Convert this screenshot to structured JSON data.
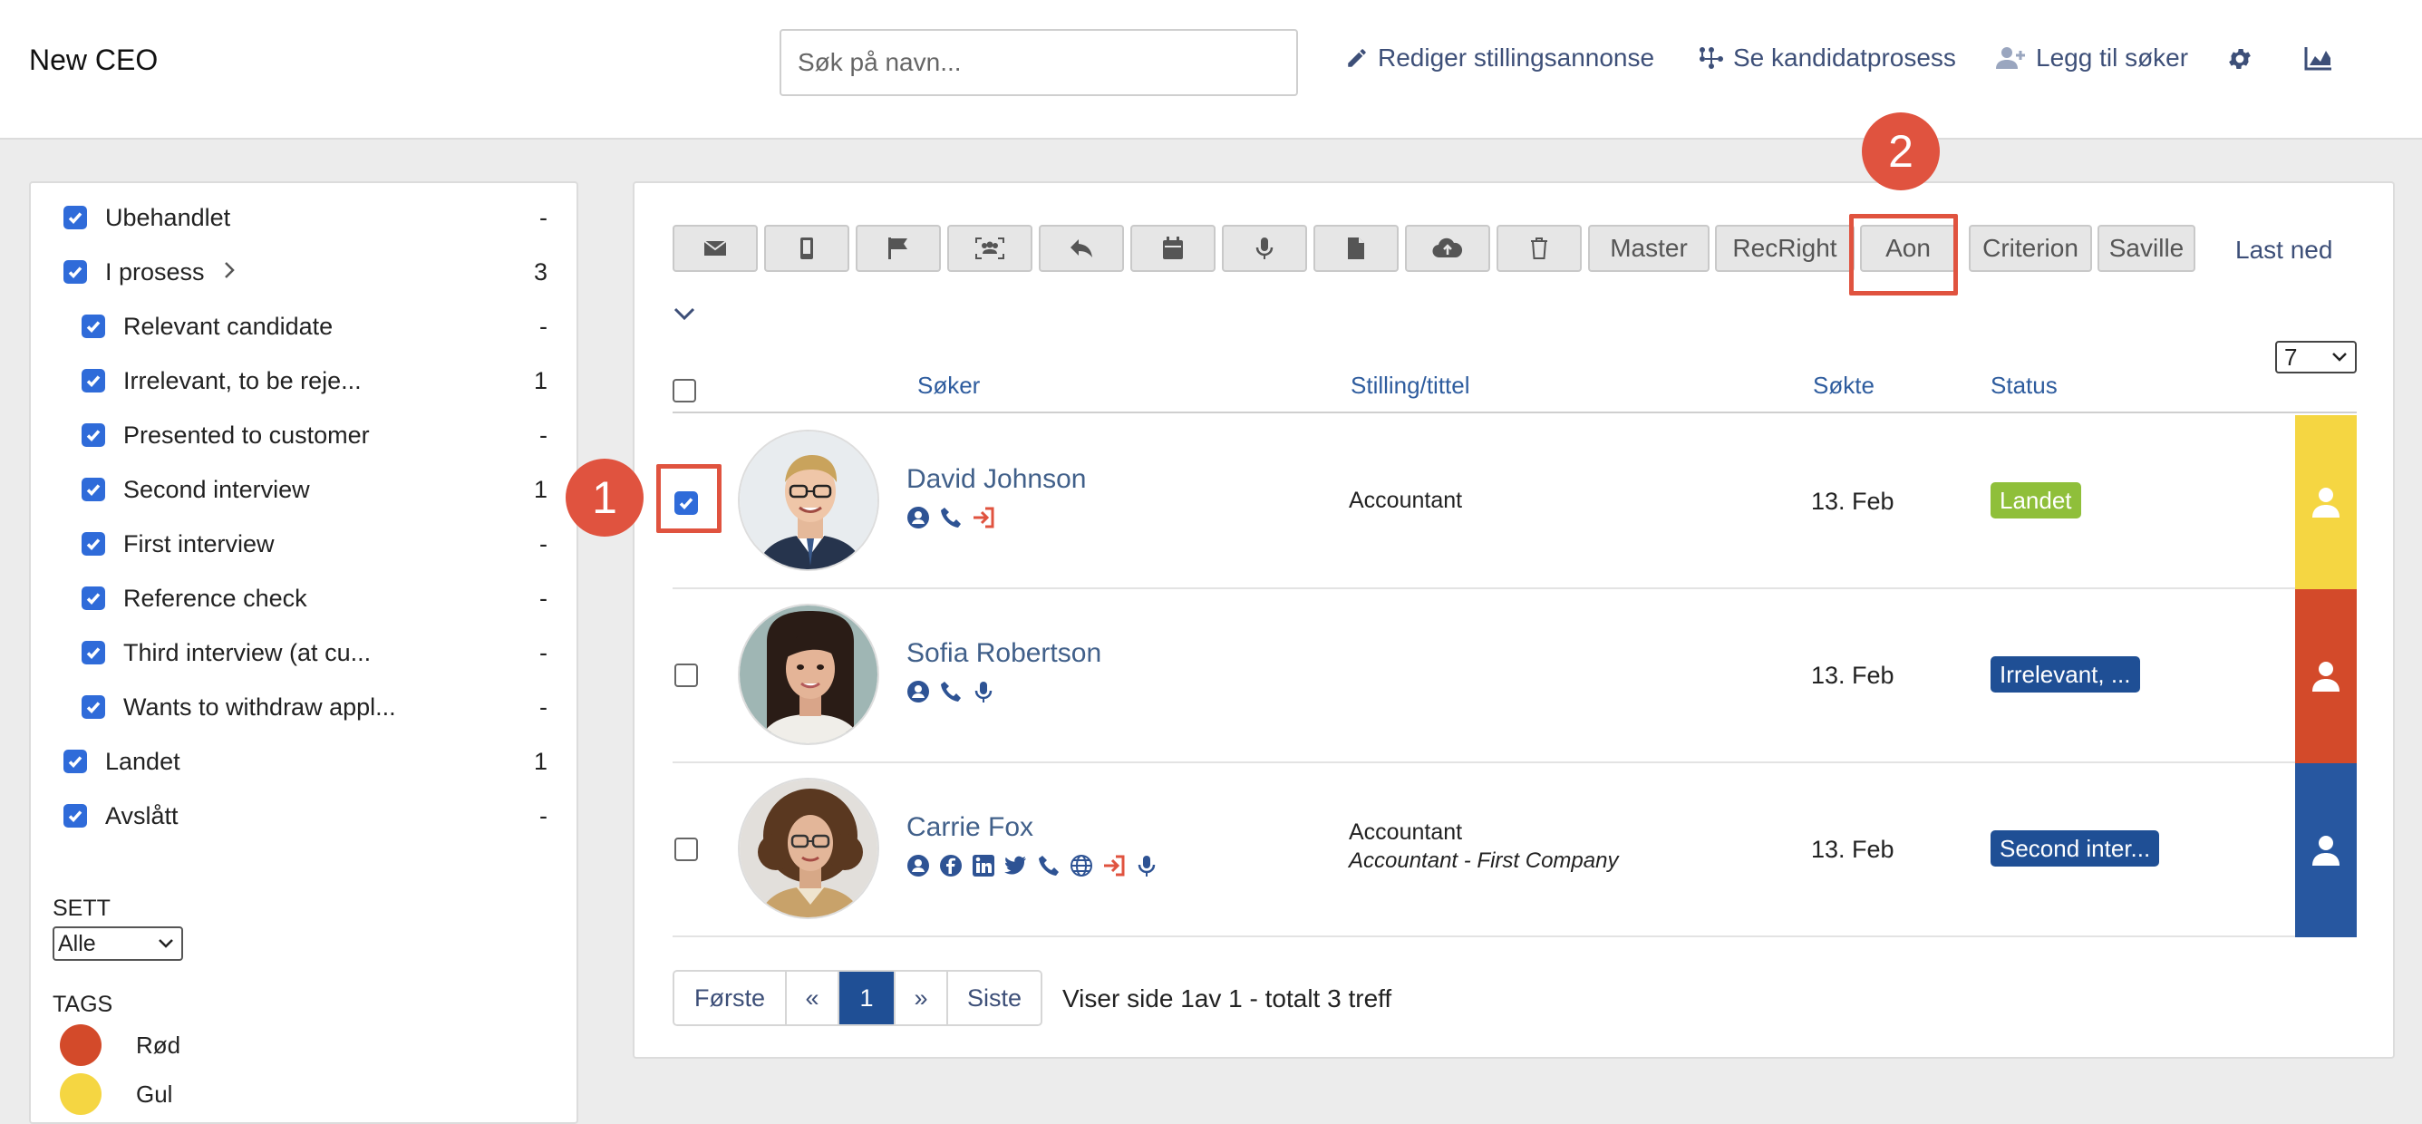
{
  "header": {
    "job_title": "New CEO",
    "search_placeholder": "Søk på navn...",
    "edit_ad_label": "Rediger stillingsannonse",
    "candidate_process_label": "Se kandidatprosess",
    "add_applicant_label": "Legg til søker"
  },
  "sidebar": {
    "filters": [
      {
        "label": "Ubehandlet",
        "count": "-",
        "indent": 0
      },
      {
        "label": "I prosess",
        "count": "3",
        "indent": 0,
        "expandable": true
      },
      {
        "label": "Relevant candidate",
        "count": "-",
        "indent": 1
      },
      {
        "label": "Irrelevant, to be reje...",
        "count": "1",
        "indent": 1
      },
      {
        "label": "Presented to customer",
        "count": "-",
        "indent": 1
      },
      {
        "label": "Second interview",
        "count": "1",
        "indent": 1
      },
      {
        "label": "First interview",
        "count": "-",
        "indent": 1
      },
      {
        "label": "Reference check",
        "count": "-",
        "indent": 1
      },
      {
        "label": "Third interview (at cu...",
        "count": "-",
        "indent": 1
      },
      {
        "label": "Wants to withdraw appl...",
        "count": "-",
        "indent": 1
      },
      {
        "label": "Landet",
        "count": "1",
        "indent": 0
      },
      {
        "label": "Avslått",
        "count": "-",
        "indent": 0
      }
    ],
    "sett_label": "SETT",
    "sett_value": "Alle",
    "tags_label": "TAGS",
    "tags": [
      {
        "name": "Rød",
        "color": "#d34a2a"
      },
      {
        "name": "Gul",
        "color": "#f5d642"
      }
    ]
  },
  "toolbar": {
    "text_buttons": [
      "Master",
      "RecRight",
      "Aon",
      "Criterion",
      "Saville"
    ],
    "download_label": "Last ned",
    "per_page": "7"
  },
  "annotations": {
    "first": "1",
    "second": "2"
  },
  "table": {
    "headers": {
      "applicant": "Søker",
      "position": "Stilling/tittel",
      "applied": "Søkte",
      "status": "Status"
    },
    "rows": [
      {
        "name": "David Johnson",
        "position": "Accountant",
        "position_sub": "",
        "applied": "13. Feb",
        "status": "Landet",
        "status_color": "#8fbf3a",
        "bar_color": "#f5d642",
        "checked": true
      },
      {
        "name": "Sofia Robertson",
        "position": "",
        "position_sub": "",
        "applied": "13. Feb",
        "status": "Irrelevant, ...",
        "status_color": "#1f4f95",
        "bar_color": "#d34a2a",
        "checked": false
      },
      {
        "name": "Carrie Fox",
        "position": "Accountant",
        "position_sub": "Accountant - First Company",
        "applied": "13. Feb",
        "status": "Second inter...",
        "status_color": "#1f4f95",
        "bar_color": "#2757a0",
        "checked": false
      }
    ]
  },
  "pager": {
    "first": "Første",
    "prev": "«",
    "current": "1",
    "next": "»",
    "last": "Siste",
    "info_prefix": "Viser side ",
    "info_page": "1",
    "info_of": "av ",
    "info_total_pages": "1",
    "info_mid": " - totalt ",
    "info_count": "3",
    "info_suffix": " treff"
  }
}
